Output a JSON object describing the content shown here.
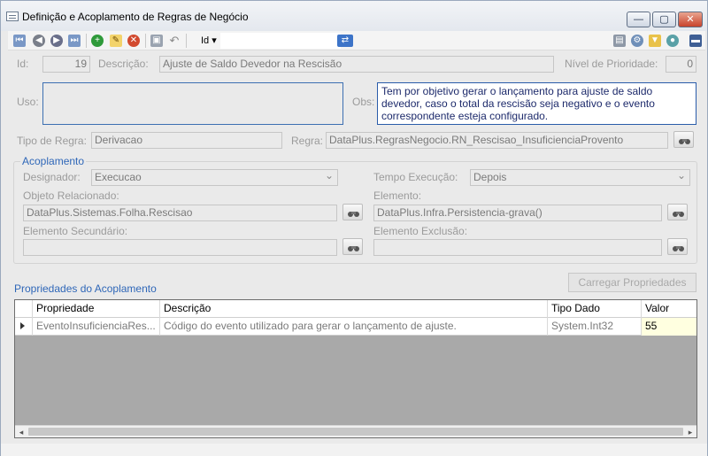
{
  "window": {
    "title": "Definição e Acoplamento de Regras de Negócio",
    "controls": {
      "minimize": "—",
      "maximize": "▢",
      "close": "✕"
    }
  },
  "toolbar": {
    "sort_field": "Id",
    "sort_arrow": "▾",
    "search_value": "",
    "icons": [
      "first-record-icon",
      "previous-record-icon",
      "next-record-icon",
      "last-record-icon",
      "add-icon",
      "edit-icon",
      "delete-icon",
      "save-icon",
      "undo-icon",
      "search-go-icon",
      "print-icon",
      "settings-icon",
      "filter-icon",
      "user-icon",
      "panel-icon"
    ]
  },
  "form": {
    "id_label": "Id:",
    "id_value": "19",
    "descricao_label": "Descrição:",
    "descricao_value": "Ajuste de Saldo Devedor na Rescisão",
    "prioridade_label": "Nível de Prioridade:",
    "prioridade_value": "0",
    "uso_label": "Uso:",
    "uso_value": "",
    "obs_label": "Obs:",
    "obs_value": "Tem por objetivo gerar o lançamento para ajuste de saldo devedor, caso o total da rescisão seja negativo e o evento correspondente esteja configurado.",
    "tipo_regra_label": "Tipo de Regra:",
    "tipo_regra_value": "Derivacao",
    "regra_label": "Regra:",
    "regra_value": "DataPlus.RegrasNegocio.RN_Rescisao_InsuficienciaProvento"
  },
  "acoplamento": {
    "title": "Acoplamento",
    "designador_label": "Designador:",
    "designador_value": "Execucao",
    "tempo_label": "Tempo Execução:",
    "tempo_value": "Depois",
    "objeto_label": "Objeto Relacionado:",
    "objeto_value": "DataPlus.Sistemas.Folha.Rescisao",
    "elemento_label": "Elemento:",
    "elemento_value": "DataPlus.Infra.Persistencia-grava()",
    "secundario_label": "Elemento Secundário:",
    "secundario_value": "",
    "exclusao_label": "Elemento Exclusão:",
    "exclusao_value": ""
  },
  "propriedades": {
    "title": "Propriedades do Acoplamento",
    "load_button": "Carregar Propriedades",
    "columns": [
      "Propriedade",
      "Descrição",
      "Tipo Dado",
      "Valor"
    ],
    "rows": [
      {
        "propriedade": "EventoInsuficienciaRes...",
        "descricao": "Código do evento utilizado para gerar o lançamento de ajuste.",
        "tipo": "System.Int32",
        "valor": "55"
      }
    ],
    "scroll_left": "◂",
    "scroll_right": "▸"
  }
}
